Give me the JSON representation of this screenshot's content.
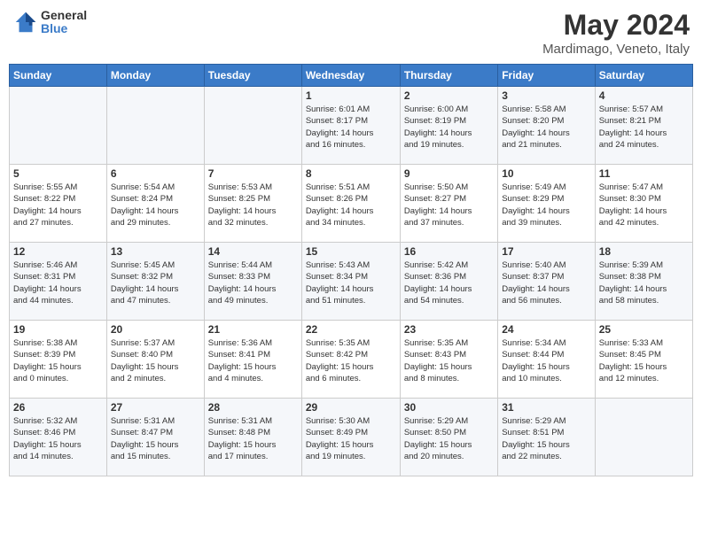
{
  "header": {
    "logo_general": "General",
    "logo_blue": "Blue",
    "month_title": "May 2024",
    "location": "Mardimago, Veneto, Italy"
  },
  "days_of_week": [
    "Sunday",
    "Monday",
    "Tuesday",
    "Wednesday",
    "Thursday",
    "Friday",
    "Saturday"
  ],
  "weeks": [
    [
      {
        "day": "",
        "info": ""
      },
      {
        "day": "",
        "info": ""
      },
      {
        "day": "",
        "info": ""
      },
      {
        "day": "1",
        "info": "Sunrise: 6:01 AM\nSunset: 8:17 PM\nDaylight: 14 hours\nand 16 minutes."
      },
      {
        "day": "2",
        "info": "Sunrise: 6:00 AM\nSunset: 8:19 PM\nDaylight: 14 hours\nand 19 minutes."
      },
      {
        "day": "3",
        "info": "Sunrise: 5:58 AM\nSunset: 8:20 PM\nDaylight: 14 hours\nand 21 minutes."
      },
      {
        "day": "4",
        "info": "Sunrise: 5:57 AM\nSunset: 8:21 PM\nDaylight: 14 hours\nand 24 minutes."
      }
    ],
    [
      {
        "day": "5",
        "info": "Sunrise: 5:55 AM\nSunset: 8:22 PM\nDaylight: 14 hours\nand 27 minutes."
      },
      {
        "day": "6",
        "info": "Sunrise: 5:54 AM\nSunset: 8:24 PM\nDaylight: 14 hours\nand 29 minutes."
      },
      {
        "day": "7",
        "info": "Sunrise: 5:53 AM\nSunset: 8:25 PM\nDaylight: 14 hours\nand 32 minutes."
      },
      {
        "day": "8",
        "info": "Sunrise: 5:51 AM\nSunset: 8:26 PM\nDaylight: 14 hours\nand 34 minutes."
      },
      {
        "day": "9",
        "info": "Sunrise: 5:50 AM\nSunset: 8:27 PM\nDaylight: 14 hours\nand 37 minutes."
      },
      {
        "day": "10",
        "info": "Sunrise: 5:49 AM\nSunset: 8:29 PM\nDaylight: 14 hours\nand 39 minutes."
      },
      {
        "day": "11",
        "info": "Sunrise: 5:47 AM\nSunset: 8:30 PM\nDaylight: 14 hours\nand 42 minutes."
      }
    ],
    [
      {
        "day": "12",
        "info": "Sunrise: 5:46 AM\nSunset: 8:31 PM\nDaylight: 14 hours\nand 44 minutes."
      },
      {
        "day": "13",
        "info": "Sunrise: 5:45 AM\nSunset: 8:32 PM\nDaylight: 14 hours\nand 47 minutes."
      },
      {
        "day": "14",
        "info": "Sunrise: 5:44 AM\nSunset: 8:33 PM\nDaylight: 14 hours\nand 49 minutes."
      },
      {
        "day": "15",
        "info": "Sunrise: 5:43 AM\nSunset: 8:34 PM\nDaylight: 14 hours\nand 51 minutes."
      },
      {
        "day": "16",
        "info": "Sunrise: 5:42 AM\nSunset: 8:36 PM\nDaylight: 14 hours\nand 54 minutes."
      },
      {
        "day": "17",
        "info": "Sunrise: 5:40 AM\nSunset: 8:37 PM\nDaylight: 14 hours\nand 56 minutes."
      },
      {
        "day": "18",
        "info": "Sunrise: 5:39 AM\nSunset: 8:38 PM\nDaylight: 14 hours\nand 58 minutes."
      }
    ],
    [
      {
        "day": "19",
        "info": "Sunrise: 5:38 AM\nSunset: 8:39 PM\nDaylight: 15 hours\nand 0 minutes."
      },
      {
        "day": "20",
        "info": "Sunrise: 5:37 AM\nSunset: 8:40 PM\nDaylight: 15 hours\nand 2 minutes."
      },
      {
        "day": "21",
        "info": "Sunrise: 5:36 AM\nSunset: 8:41 PM\nDaylight: 15 hours\nand 4 minutes."
      },
      {
        "day": "22",
        "info": "Sunrise: 5:35 AM\nSunset: 8:42 PM\nDaylight: 15 hours\nand 6 minutes."
      },
      {
        "day": "23",
        "info": "Sunrise: 5:35 AM\nSunset: 8:43 PM\nDaylight: 15 hours\nand 8 minutes."
      },
      {
        "day": "24",
        "info": "Sunrise: 5:34 AM\nSunset: 8:44 PM\nDaylight: 15 hours\nand 10 minutes."
      },
      {
        "day": "25",
        "info": "Sunrise: 5:33 AM\nSunset: 8:45 PM\nDaylight: 15 hours\nand 12 minutes."
      }
    ],
    [
      {
        "day": "26",
        "info": "Sunrise: 5:32 AM\nSunset: 8:46 PM\nDaylight: 15 hours\nand 14 minutes."
      },
      {
        "day": "27",
        "info": "Sunrise: 5:31 AM\nSunset: 8:47 PM\nDaylight: 15 hours\nand 15 minutes."
      },
      {
        "day": "28",
        "info": "Sunrise: 5:31 AM\nSunset: 8:48 PM\nDaylight: 15 hours\nand 17 minutes."
      },
      {
        "day": "29",
        "info": "Sunrise: 5:30 AM\nSunset: 8:49 PM\nDaylight: 15 hours\nand 19 minutes."
      },
      {
        "day": "30",
        "info": "Sunrise: 5:29 AM\nSunset: 8:50 PM\nDaylight: 15 hours\nand 20 minutes."
      },
      {
        "day": "31",
        "info": "Sunrise: 5:29 AM\nSunset: 8:51 PM\nDaylight: 15 hours\nand 22 minutes."
      },
      {
        "day": "",
        "info": ""
      }
    ]
  ]
}
